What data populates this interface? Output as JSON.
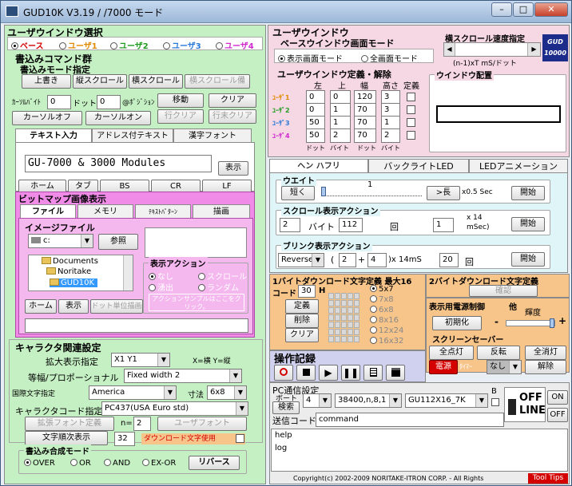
{
  "window": {
    "title": "GUD10K V3.19 / /7000 モード"
  },
  "left": {
    "user_window_select": {
      "title": "ユーザウインドウ選択",
      "options": [
        "ベース",
        "ユーザ1",
        "ユーザ2",
        "ユーザ3",
        "ユーザ4"
      ],
      "selected": 0
    },
    "write_cmd": {
      "title": "書込みコマンド群",
      "mode_title": "書込みモード指定",
      "overwrite": "上書き",
      "vscroll": "縦スクロール",
      "hscroll": "横スクロール",
      "hscroll_rep": "横スクロール備"
    },
    "cursor": {
      "label1": "ｶｰｿﾙﾊﾞｲﾄ",
      "val1": "0",
      "label2": "ドット",
      "val2": "0",
      "label3": "@ﾎﾟｼﾞｼｮﾝ",
      "move": "移動",
      "clear": "クリア",
      "cursor_off": "カーソルオフ",
      "cursor_on": "カーソルオン",
      "line_clear": "行クリア",
      "line_end_clear": "行末クリア"
    },
    "text_tabs": [
      "テキスト入力",
      "アドレス付テキスト",
      "漢字フォント"
    ],
    "text_input": "GU-7000 & 3000 Modules",
    "display": "表示",
    "keys": [
      "ホーム",
      "タブ",
      "BS",
      "CR",
      "LF"
    ],
    "bitmap": {
      "title": "ビットマップ画像表示",
      "tabs": [
        "ファイル",
        "メモリ",
        "ﾃｷｽﾄﾊﾟﾀｰﾝ",
        "描画"
      ],
      "image_file": "イメージファイル",
      "drive": "c:",
      "browse": "参照",
      "folders": [
        "Documents",
        "Noritake",
        "GUD10K"
      ],
      "action_title": "表示アクション",
      "actions": [
        "なし",
        "スクロール",
        "湧出",
        "ランダム"
      ],
      "action_note": "アクションサンプルはここをクリック。",
      "home": "ホーム",
      "show": "表示",
      "dot_unit": "ドット単位描画"
    },
    "char": {
      "title": "キャラクタ関連設定",
      "magnify": "拡大表示指定",
      "magnify_val": "X1 Y1",
      "xy_note": "X=横 Y=縦",
      "prop": "等幅/プロポーショナル",
      "prop_val": "Fixed width 2",
      "intl": "国際文字指定",
      "intl_val": "America",
      "size": "寸法",
      "size_val": "6x8",
      "charset": "キャラクタコード指定",
      "charset_val": "PC437(USA Euro std)",
      "ext_font": "拡張フォント定義",
      "n_label": "n=",
      "n_val": "2",
      "user_font": "ユーザフォント",
      "seq": "文字順次表示",
      "seq_val": "32",
      "download": "ダウンロード文字使用"
    },
    "compose": {
      "title": "書込み合成モード",
      "options": [
        "OVER",
        "OR",
        "AND",
        "EX-OR"
      ],
      "selected": 0,
      "reverse": "リバース"
    }
  },
  "right": {
    "user_window": {
      "title": "ユーザウインドウ",
      "base_title": "ベースウインドウ画面モード",
      "modes": [
        "表示画面モード",
        "全画面モード"
      ],
      "mode_selected": 0,
      "hscroll_title": "横スクロール速度指定",
      "hscroll_note": "(n-1)xT mS/ドット",
      "logo": "GUD 10000",
      "def_title": "ユーザウインドウ定義・解除",
      "cols": [
        "左",
        "上",
        "幅",
        "高さ",
        "定義"
      ],
      "rows": [
        {
          "name": "ﾕｰｻﾞ1",
          "left": "0",
          "top": "0",
          "width": "120",
          "height": "3"
        },
        {
          "name": "ﾕｰｻﾞ2",
          "left": "0",
          "top": "1",
          "width": "70",
          "height": "3"
        },
        {
          "name": "ﾕｰｻﾞ3",
          "left": "50",
          "top": "1",
          "width": "70",
          "height": "1"
        },
        {
          "name": "ﾕｰｻﾞ4",
          "left": "50",
          "top": "2",
          "width": "70",
          "height": "2"
        }
      ],
      "units": [
        "ドット",
        "バイト",
        "ドット",
        "バイト"
      ],
      "layout_title": "ウインドウ配置"
    },
    "tabs": [
      "ヘン ハフリ",
      "バックライトLED",
      "LEDアニメーション"
    ],
    "wait": {
      "title": "ウエイト",
      "short": "短く",
      "value": "1",
      "long": ">長",
      "unit": "x0.5 Sec",
      "start": "開始"
    },
    "scroll": {
      "title": "スクロール表示アクション",
      "val1": "2",
      "byte": "バイト",
      "val2": "112",
      "cycle": "回",
      "val3": "1",
      "unit1": "x 14",
      "unit2": "mSec)",
      "start": "開始"
    },
    "blink": {
      "title": "ブリンク表示アクション",
      "mode": "Reverse",
      "paren_open": "(",
      "a": "2",
      "plus": "+",
      "b": "4",
      "unit": ")x 14mS",
      "count": "20",
      "cycle": "回",
      "start": "開始"
    },
    "font1": {
      "title": "1バイトダウンロード文字定義 最大16",
      "code": "コード",
      "code_val": "30",
      "h": "H",
      "define": "定義",
      "delete": "削除",
      "clear": "クリア",
      "sizes": [
        "5x7",
        "7x8",
        "6x8",
        "8x16",
        "12x24",
        "16x32"
      ],
      "selected": 0
    },
    "font2": {
      "title": "2バイトダウンロード文字定義",
      "confirm": "確認"
    },
    "power": {
      "title": "表示用電源制御",
      "other": "他",
      "init": "初期化",
      "brightness": "輝度",
      "minus": "-",
      "plus": "+"
    },
    "saver": {
      "title": "スクリーンセーバー",
      "all_on": "全点灯",
      "invert": "反転",
      "all_off": "全消灯",
      "power": "電源",
      "timer": "ﾀｲﾏｰ",
      "timer_val": "なし",
      "release": "解除"
    },
    "record": {
      "title": "操作記録"
    },
    "pc": {
      "title": "PC通信設定",
      "port": "ボート",
      "search": "検索",
      "port_val": "4",
      "baud": "38400,n,8,1",
      "model": "GU112X16_7K",
      "b": "B",
      "on": "ON",
      "off": "OFF",
      "offline1": "OFF",
      "offline2": "LINE",
      "send_label": "送信コード",
      "send_val": "command",
      "help": "help",
      "log": "log"
    },
    "footer": {
      "copyright": "Copyright(c) 2002-2009 NORITAKE-ITRON CORP. - All Rights",
      "tooltips": "Tool Tips"
    }
  },
  "colors": {
    "accent_red": "#d40000",
    "user1": "#e08a00",
    "user2": "#1f9c1f",
    "user3": "#2a7ad8",
    "user4": "#d02ad0"
  }
}
